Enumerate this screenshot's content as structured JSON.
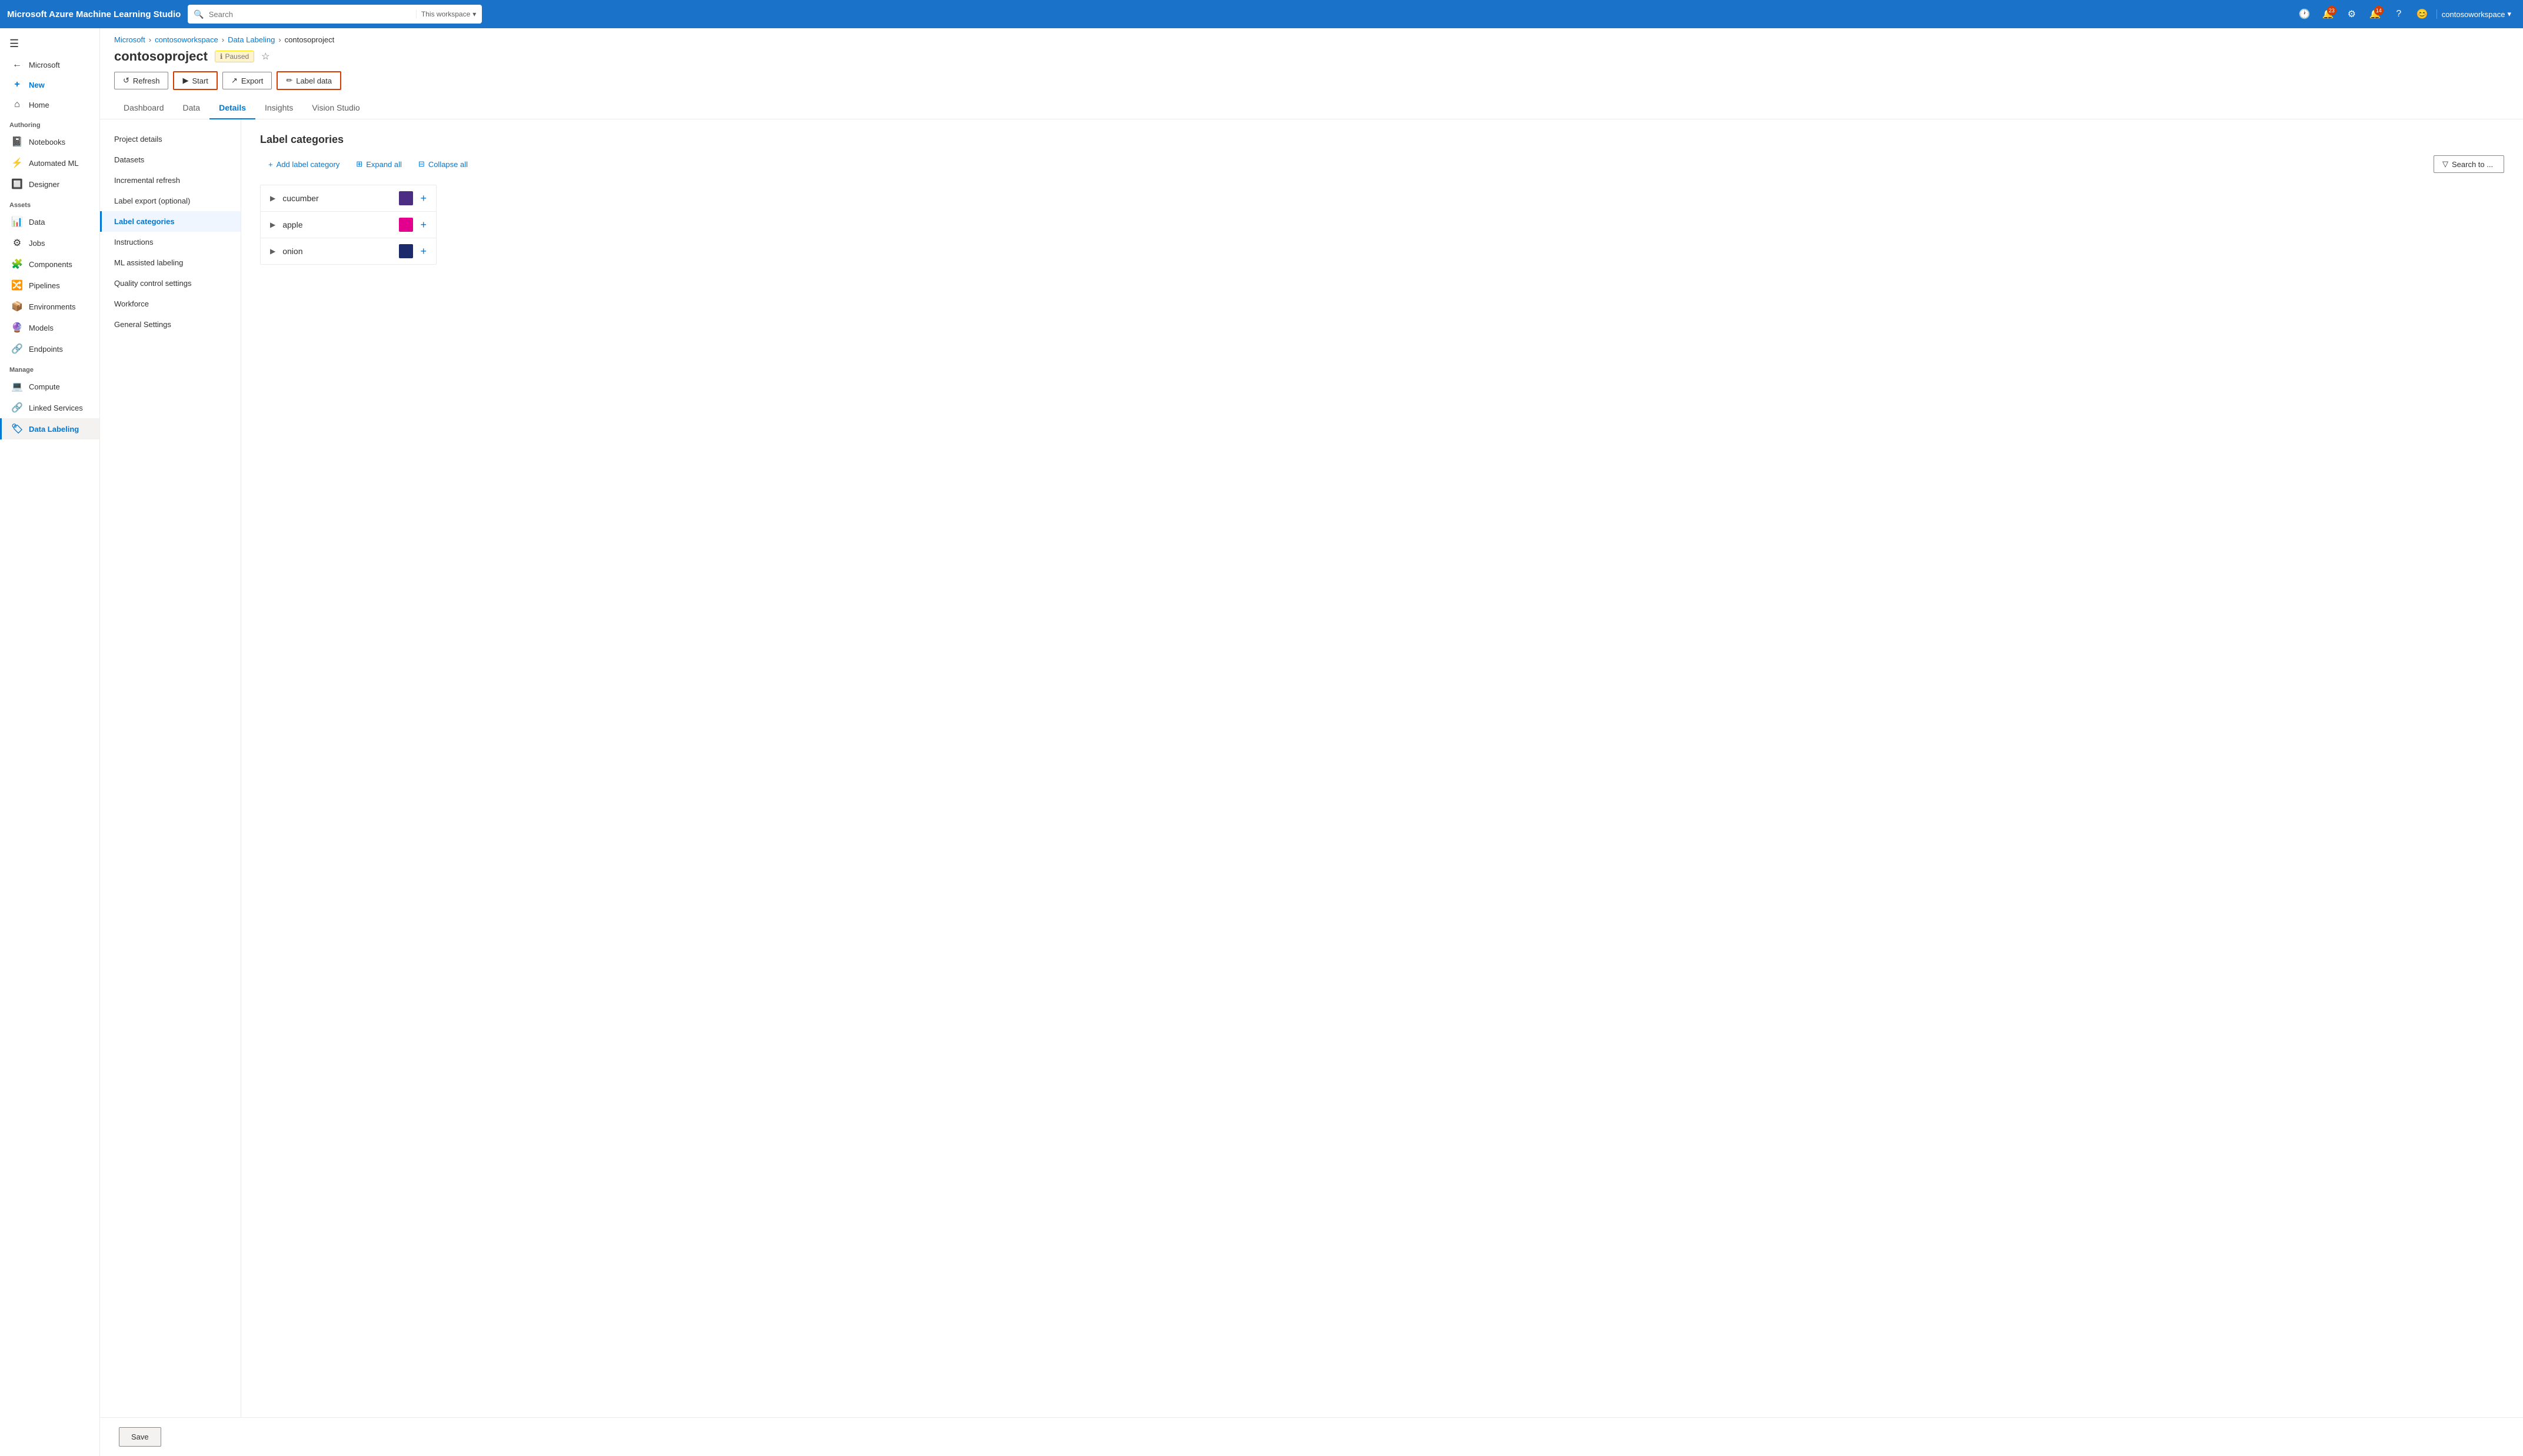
{
  "app": {
    "brand": "Microsoft Azure Machine Learning Studio",
    "search": {
      "placeholder": "Search",
      "scope": "This workspace"
    },
    "notifications_count": "23",
    "alerts_count": "14",
    "user": "contosoworkspace"
  },
  "sidebar": {
    "hamburger_icon": "☰",
    "back_label": "Microsoft",
    "items": [
      {
        "id": "new",
        "label": "New",
        "icon": "+"
      },
      {
        "id": "home",
        "label": "Home",
        "icon": "⌂"
      }
    ],
    "authoring_label": "Authoring",
    "authoring_items": [
      {
        "id": "notebooks",
        "label": "Notebooks",
        "icon": "📓"
      },
      {
        "id": "automated-ml",
        "label": "Automated ML",
        "icon": "⚡"
      },
      {
        "id": "designer",
        "label": "Designer",
        "icon": "🔲"
      }
    ],
    "assets_label": "Assets",
    "assets_items": [
      {
        "id": "data",
        "label": "Data",
        "icon": "📊"
      },
      {
        "id": "jobs",
        "label": "Jobs",
        "icon": "⚙"
      },
      {
        "id": "components",
        "label": "Components",
        "icon": "🧩"
      },
      {
        "id": "pipelines",
        "label": "Pipelines",
        "icon": "🔀"
      },
      {
        "id": "environments",
        "label": "Environments",
        "icon": "📦"
      },
      {
        "id": "models",
        "label": "Models",
        "icon": "🔮"
      },
      {
        "id": "endpoints",
        "label": "Endpoints",
        "icon": "🔗"
      }
    ],
    "manage_label": "Manage",
    "manage_items": [
      {
        "id": "compute",
        "label": "Compute",
        "icon": "💻"
      },
      {
        "id": "linked-services",
        "label": "Linked Services",
        "icon": "🔗"
      },
      {
        "id": "data-labeling",
        "label": "Data Labeling",
        "icon": "🏷",
        "active": true
      }
    ]
  },
  "breadcrumb": {
    "items": [
      "Microsoft",
      "contosoworkspace",
      "Data Labeling",
      "contosoproject"
    ]
  },
  "page": {
    "title": "contosoproject",
    "status": "Paused",
    "star_icon": "☆"
  },
  "toolbar": {
    "refresh_label": "Refresh",
    "start_label": "Start",
    "export_label": "Export",
    "label_data_label": "Label data"
  },
  "tabs": [
    {
      "id": "dashboard",
      "label": "Dashboard"
    },
    {
      "id": "data",
      "label": "Data"
    },
    {
      "id": "details",
      "label": "Details",
      "active": true
    },
    {
      "id": "insights",
      "label": "Insights"
    },
    {
      "id": "vision-studio",
      "label": "Vision Studio"
    }
  ],
  "left_panel": {
    "items": [
      {
        "id": "project-details",
        "label": "Project details"
      },
      {
        "id": "datasets",
        "label": "Datasets"
      },
      {
        "id": "incremental-refresh",
        "label": "Incremental refresh"
      },
      {
        "id": "label-export",
        "label": "Label export (optional)"
      },
      {
        "id": "label-categories",
        "label": "Label categories",
        "active": true
      },
      {
        "id": "instructions",
        "label": "Instructions"
      },
      {
        "id": "ml-assisted",
        "label": "ML assisted labeling"
      },
      {
        "id": "quality-control",
        "label": "Quality control settings"
      },
      {
        "id": "workforce",
        "label": "Workforce"
      },
      {
        "id": "general-settings",
        "label": "General Settings"
      }
    ]
  },
  "label_categories": {
    "title": "Label categories",
    "add_label_btn": "Add label category",
    "expand_all_btn": "Expand all",
    "collapse_all_btn": "Collapse all",
    "search_placeholder": "Search to ...",
    "items": [
      {
        "id": "cucumber",
        "name": "cucumber",
        "color": "#4b2d83"
      },
      {
        "id": "apple",
        "name": "apple",
        "color": "#e3008c"
      },
      {
        "id": "onion",
        "name": "onion",
        "color": "#1b2a6b"
      }
    ]
  },
  "save_btn_label": "Save"
}
